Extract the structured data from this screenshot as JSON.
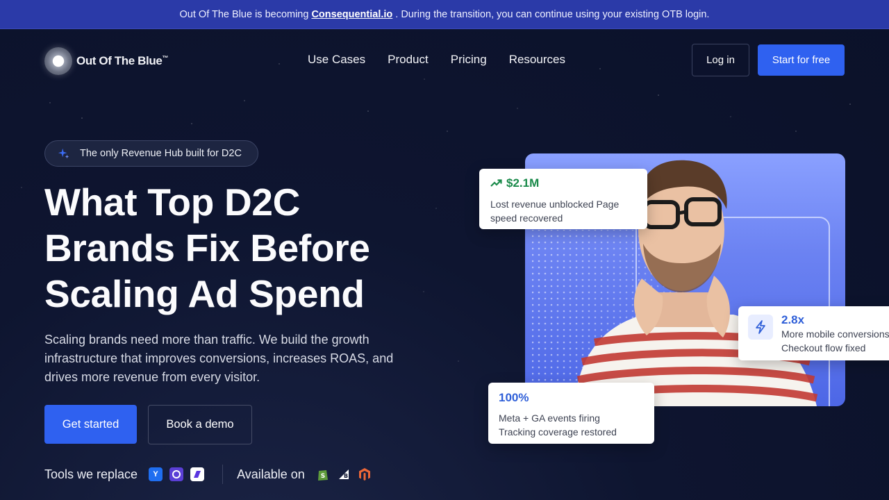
{
  "banner": {
    "prefix": "Out Of The Blue is becoming",
    "link": "Consequential.io",
    "suffix": ". During the transition, you can continue using your existing OTB login."
  },
  "nav": {
    "logo_text": "Out Of The Blue",
    "logo_tm": "™",
    "links": [
      "Use Cases",
      "Product",
      "Pricing",
      "Resources"
    ],
    "login_label": "Log in",
    "start_label": "Start for free"
  },
  "hero": {
    "pill_text": "The only Revenue Hub built for D2C",
    "title_line1": "What Top D2C",
    "title_line2": "Brands Fix Before",
    "title_line3": "Scaling Ad Spend",
    "subtitle": "Scaling brands need more than traffic. We build the growth infrastructure that improves conversions, increases ROAS, and drives more revenue from every visitor.",
    "get_started_label": "Get started",
    "book_demo_label": "Book a demo",
    "tools_label": "Tools we replace",
    "available_label": "Available on"
  },
  "stats": {
    "card1": {
      "value": "$2.1M",
      "line1": "Lost revenue unblocked Page",
      "line2": "speed recovered"
    },
    "card2": {
      "value": "2.8x",
      "line1": "More mobile conversions",
      "line2": "Checkout flow fixed"
    },
    "card3": {
      "value": "100%",
      "line1": "Meta + GA events firing",
      "line2": "Tracking coverage restored"
    }
  },
  "colors": {
    "accent": "#2f61f0",
    "banner": "#2b3aa8",
    "background": "#0e1530",
    "positive": "#1a8a4a",
    "stat_blue": "#2f5fd8"
  },
  "icons": {
    "tools": [
      "tool-y-icon",
      "tool-circle-icon",
      "tool-slash-icon"
    ],
    "platforms": [
      "shopify-icon",
      "bigcommerce-icon",
      "magento-icon"
    ]
  }
}
